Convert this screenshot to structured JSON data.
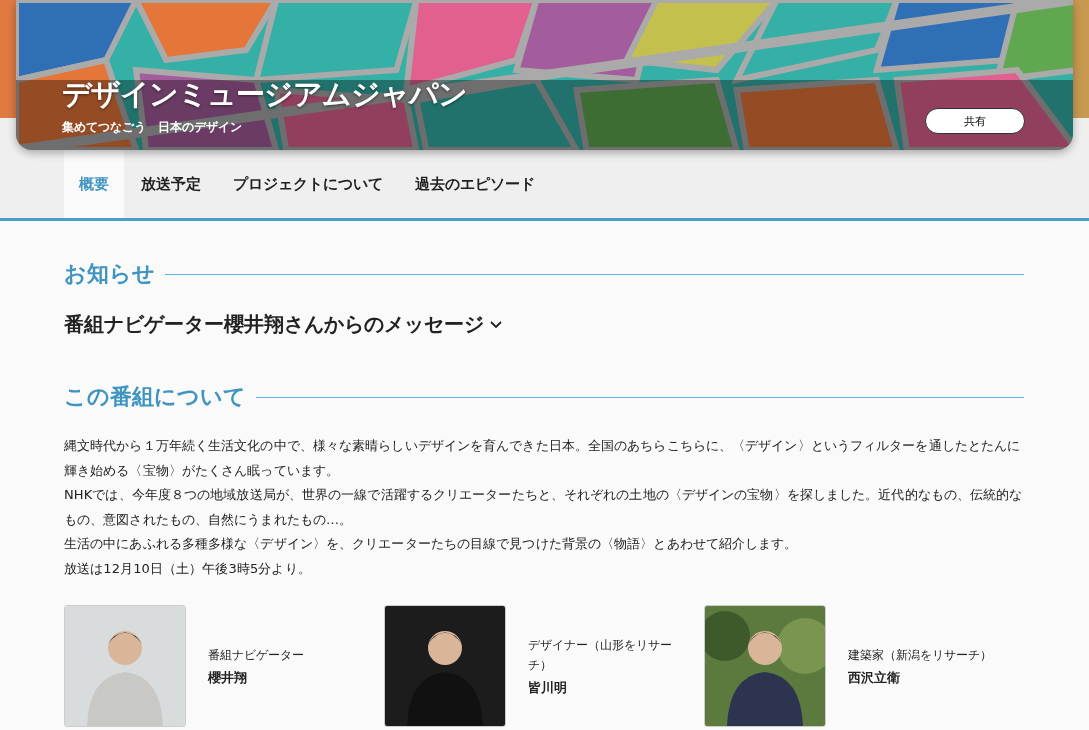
{
  "header": {
    "title": "デザインミュージアムジャパン",
    "subtitle": "集めてつなごう　日本のデザイン",
    "share_button": "共有"
  },
  "tabs": [
    {
      "label": "概要",
      "selected": true
    },
    {
      "label": "放送予定",
      "selected": false
    },
    {
      "label": "プロジェクトについて",
      "selected": false
    },
    {
      "label": "過去のエピソード",
      "selected": false
    }
  ],
  "notice": {
    "heading": "お知らせ",
    "item": {
      "label": "番組ナビゲーター櫻井翔さんからのメッセージ",
      "expanded": false
    }
  },
  "about": {
    "heading": "この番組について",
    "paragraphs": [
      "縄文時代から１万年続く生活文化の中で、様々な素晴らしいデザインを育んできた日本。全国のあちらこちらに、〈デザイン〉というフィルターを通したとたんに輝き始める〈宝物〉がたくさん眠っています。",
      "NHKでは、今年度８つの地域放送局が、世界の一線で活躍するクリエーターたちと、それぞれの土地の〈デザインの宝物〉を探しました。近代的なもの、伝統的なもの、意図されたもの、自然にうまれたもの…。",
      "生活の中にあふれる多種多様な〈デザイン〉を、クリエーターたちの目線で見つけた背景の〈物語〉とあわせて紹介します。",
      "放送は12月10日（土）午後3時5分より。"
    ]
  },
  "people": [
    {
      "role": "番組ナビゲーター",
      "name": "櫻井翔"
    },
    {
      "role": "デザイナー（山形をリサーチ）",
      "name": "皆川明"
    },
    {
      "role": "建築家（新潟をリサーチ）",
      "name": "西沢立衛"
    }
  ]
}
